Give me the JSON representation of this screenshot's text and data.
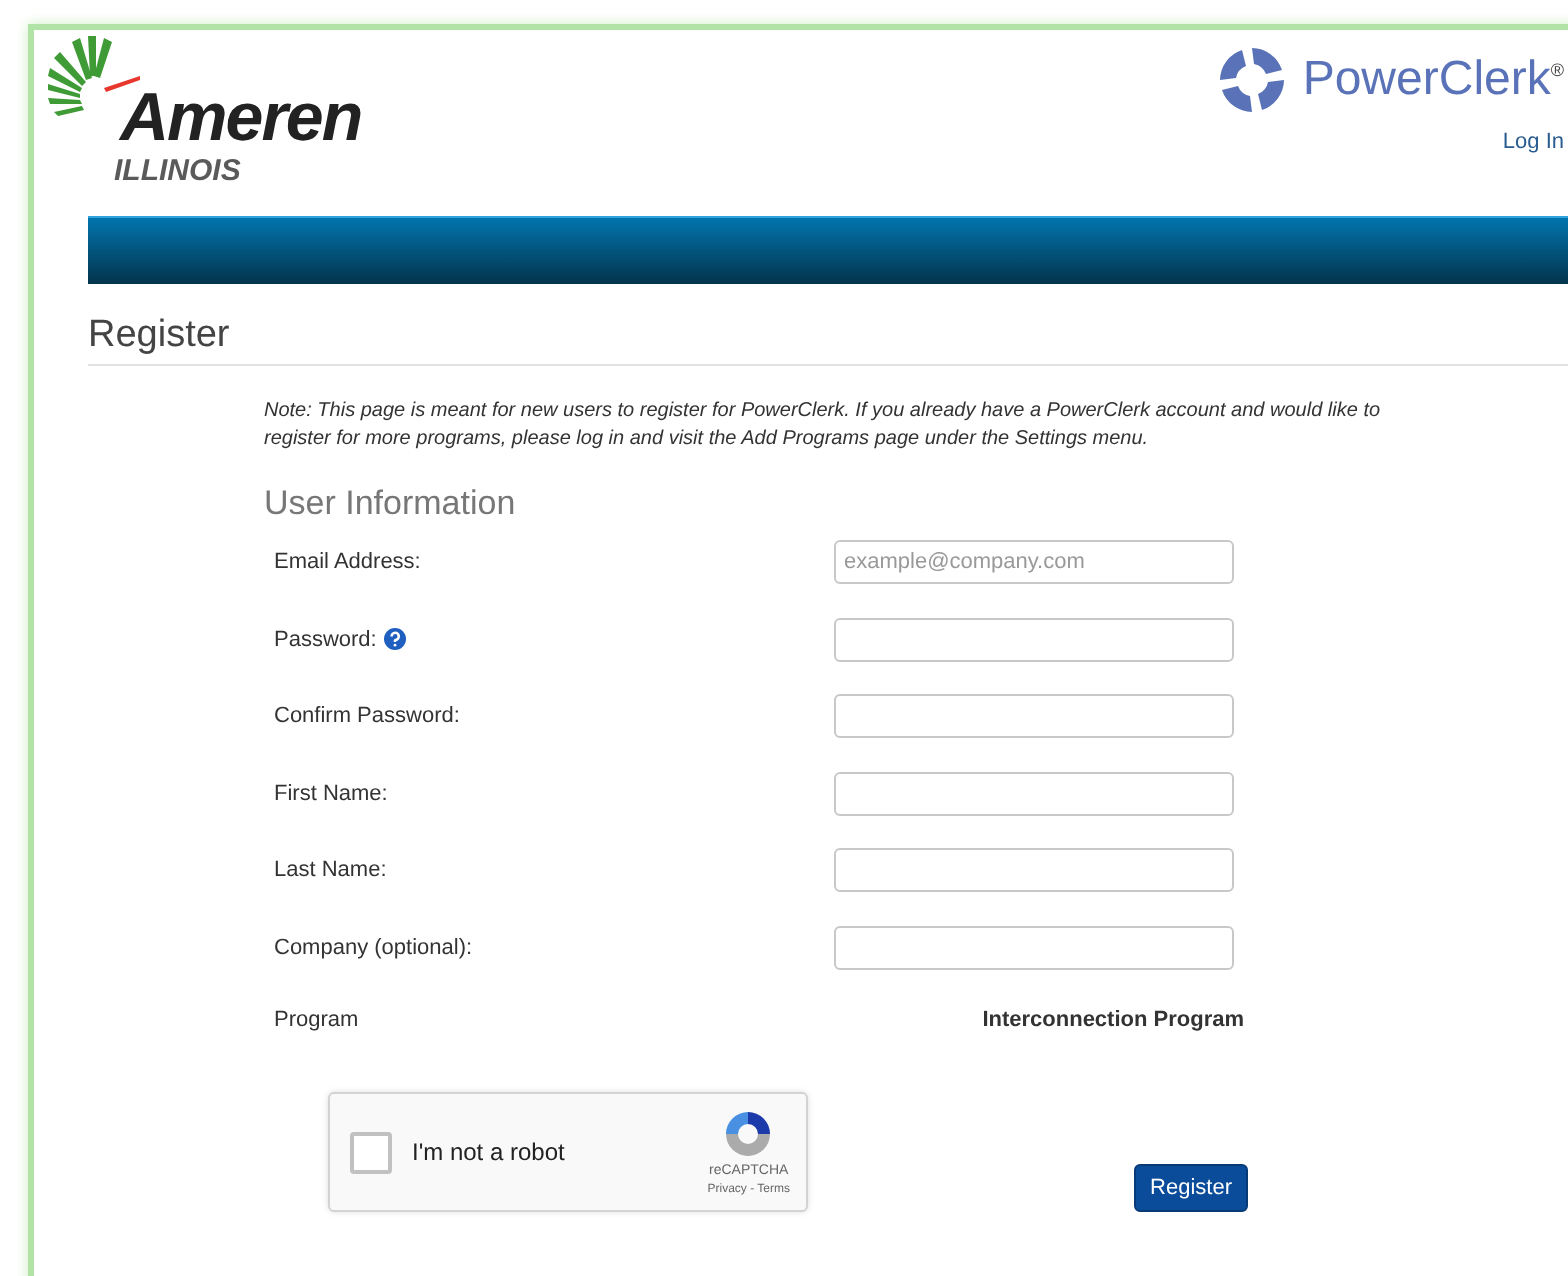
{
  "header": {
    "brand_name": "Ameren",
    "brand_region": "ILLINOIS",
    "product": "PowerClerk$^{®}$",
    "login_link": "Log In"
  },
  "page_title": "Register",
  "note": "Note: This page is meant for new users to register for PowerClerk. If you already have a PowerClerk account and would like to register for more programs, please log in and visit the Add Programs page under the Settings menu.",
  "section_title": "User Information",
  "fields": [
    {
      "label": "Email Address:",
      "placeholder": "example@company.com"
    },
    {
      "label": "Password:",
      "help": true
    },
    {
      "label": "Confirm Password:"
    },
    {
      "label": "First Name:"
    },
    {
      "label": "Last Name:"
    },
    {
      "label": "Company (optional):"
    }
  ],
  "program": {
    "label": "Program",
    "value": "Interconnection Program"
  },
  "captcha": {
    "label": "I'm not a robot",
    "checked": false,
    "brand": "reCAPTCHA",
    "links": "Privacy - Terms"
  },
  "submit_button": "Register"
}
